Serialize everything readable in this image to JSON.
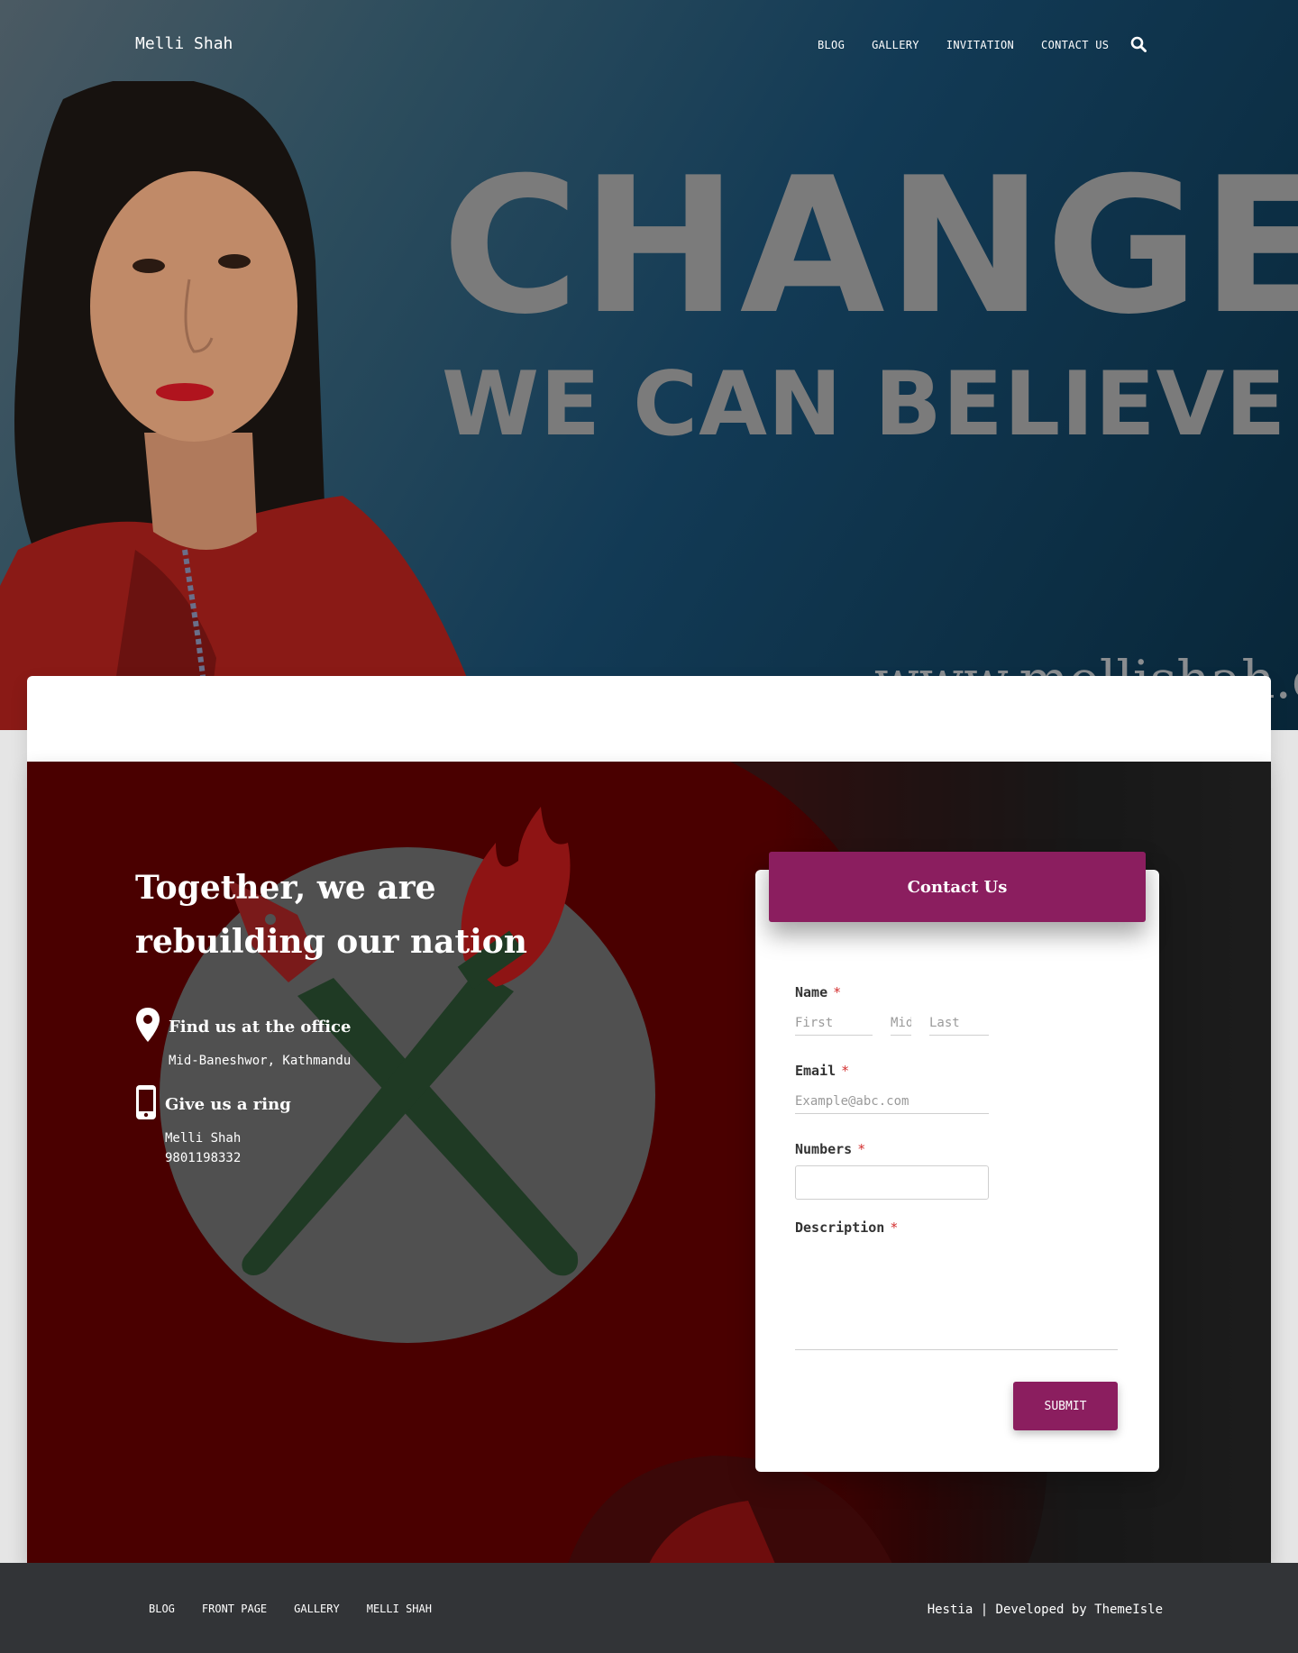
{
  "header": {
    "brand": "Melli Shah",
    "nav": [
      "BLOG",
      "GALLERY",
      "INVITATION",
      "CONTACT US"
    ]
  },
  "hero": {
    "headline_1": "CHANGE",
    "headline_2": "WE CAN BELIEVE IN",
    "url": "www.mellishah.com."
  },
  "contact": {
    "title": "Together, we are rebuilding our nation",
    "office_title": "Find us at the office",
    "office_address": "Mid-Baneshwor, Kathmandu",
    "phone_title": "Give us a ring",
    "phone_name": "Melli Shah",
    "phone_number": "9801198332"
  },
  "form": {
    "header": "Contact Us",
    "name_label": "Name",
    "name_first_placeholder": "First",
    "name_middle_placeholder": "Middle",
    "name_last_placeholder": "Last",
    "email_label": "Email",
    "email_placeholder": "Example@abc.com",
    "numbers_label": "Numbers",
    "description_label": "Description",
    "required_mark": "*",
    "submit": "SUBMIT"
  },
  "footer": {
    "links": [
      "BLOG",
      "FRONT PAGE",
      "GALLERY",
      "MELLI SHAH"
    ],
    "copyright": "Hestia | Developed by ThemeIsle"
  },
  "colors": {
    "accent": "#8b1e5f",
    "section_red": "#4a0000",
    "footer": "#323437"
  }
}
